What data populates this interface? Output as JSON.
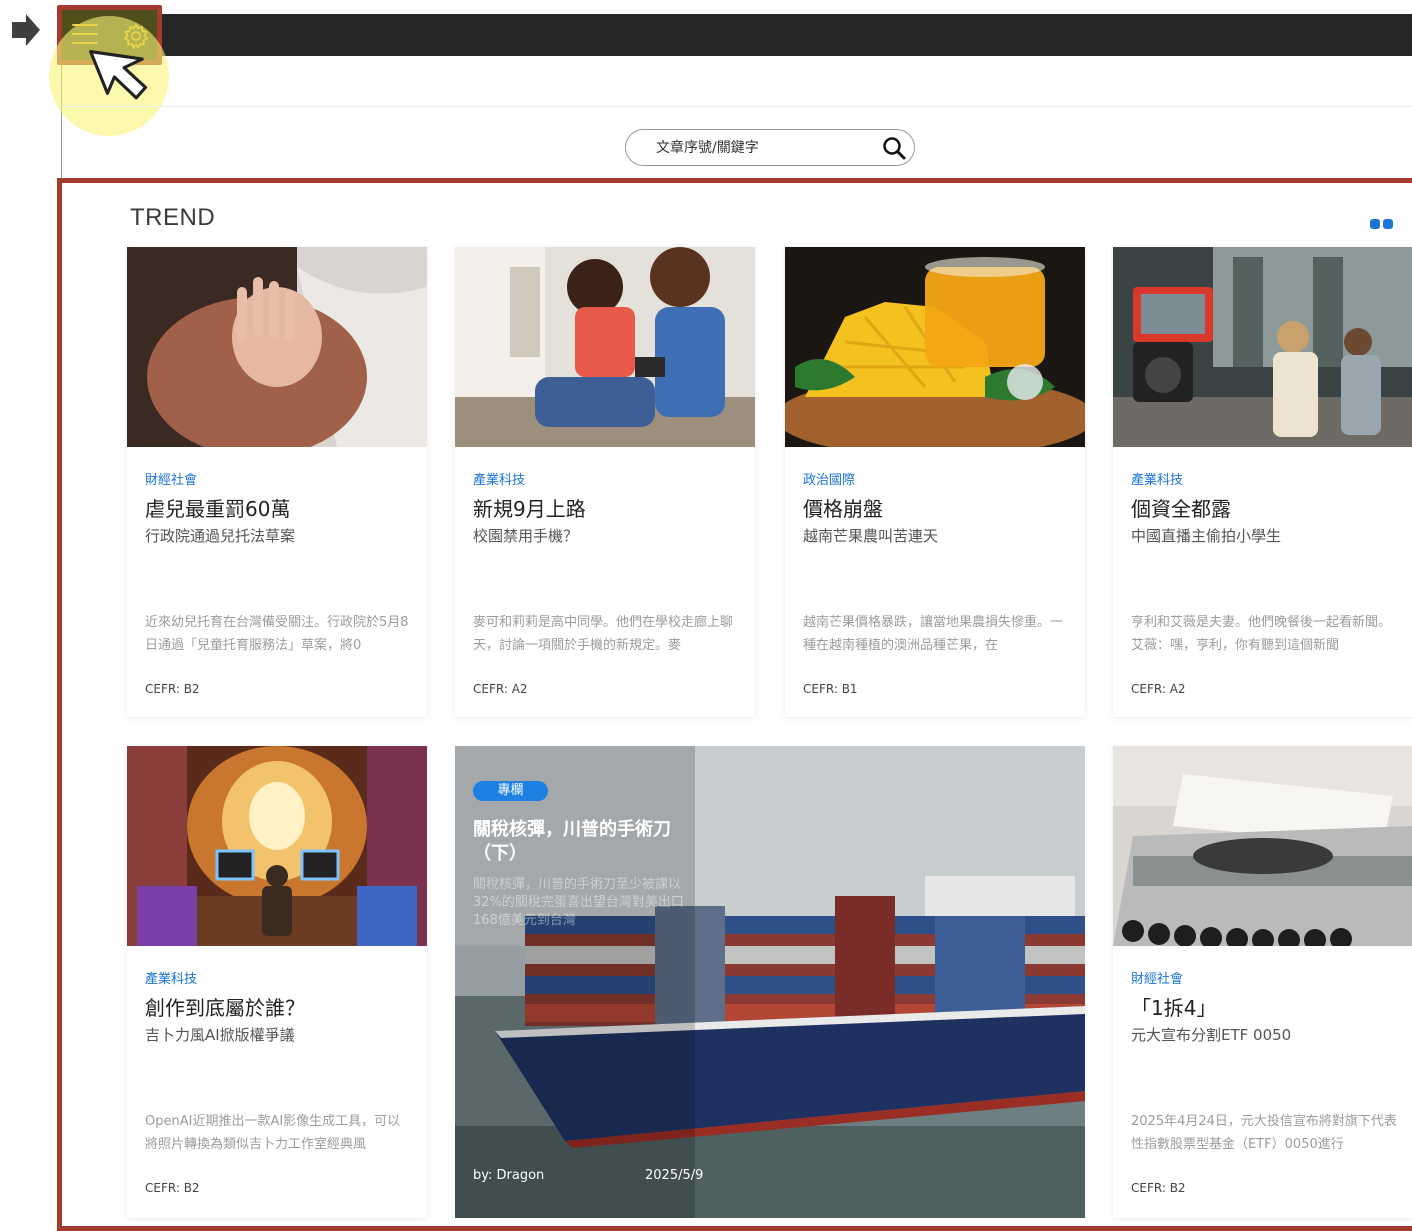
{
  "search": {
    "placeholder": "文章序號/關鍵字"
  },
  "section": {
    "title": "TREND"
  },
  "cards": [
    {
      "category": "財經社會",
      "title": "虐兒最重罰60萬",
      "subtitle": "行政院通過兒托法草案",
      "excerpt": "近來幼兒托育在台灣備受關注。行政院於5月8日通過「兒童托育服務法」草案，將0",
      "cefr": "CEFR: B2"
    },
    {
      "category": "產業科技",
      "title": "新規9月上路",
      "subtitle": "校園禁用手機？",
      "excerpt": "麥可和莉莉是高中同學。他們在學校走廊上聊天，討論一項關於手機的新規定。麥",
      "cefr": "CEFR: A2"
    },
    {
      "category": "政治國際",
      "title": "價格崩盤",
      "subtitle": "越南芒果農叫苦連天",
      "excerpt": "越南芒果價格暴跌，讓當地果農損失慘重。一種在越南種植的澳洲品種芒果，在",
      "cefr": "CEFR: B1"
    },
    {
      "category": "產業科技",
      "title": "個資全都露",
      "subtitle": "中國直播主偷拍小學生",
      "excerpt": "亨利和艾薇是夫妻。他們晚餐後一起看新聞。艾薇：嘿，亨利，你有聽到這個新聞",
      "cefr": "CEFR: A2"
    },
    {
      "category": "產業科技",
      "title": "創作到底屬於誰？",
      "subtitle": "吉卜力風AI掀版權爭議",
      "excerpt": "OpenAI近期推出一款AI影像生成工具，可以將照片轉換為類似吉卜力工作室經典風",
      "cefr": "CEFR: B2"
    },
    {
      "category": "財經社會",
      "title": "「1拆4」",
      "subtitle": "元大宣布分割ETF 0050",
      "excerpt": "2025年4月24日，元大投信宣布將對旗下代表性指數股票型基金（ETF）0050進行",
      "cefr": "CEFR: B2"
    }
  ],
  "feature": {
    "badge": "專欄",
    "title": "關稅核彈，川普的手術刀（下）",
    "excerpt": "關稅核彈，川普的手術刀至少被課以32%的關稅完蛋喜出望台灣對美出口168億美元到台灣",
    "author": "by: Dragon",
    "date": "2025/5/9"
  },
  "colors": {
    "highlight": "#a53b2f",
    "accent": "#1e73d8",
    "topbar": "#262626"
  }
}
